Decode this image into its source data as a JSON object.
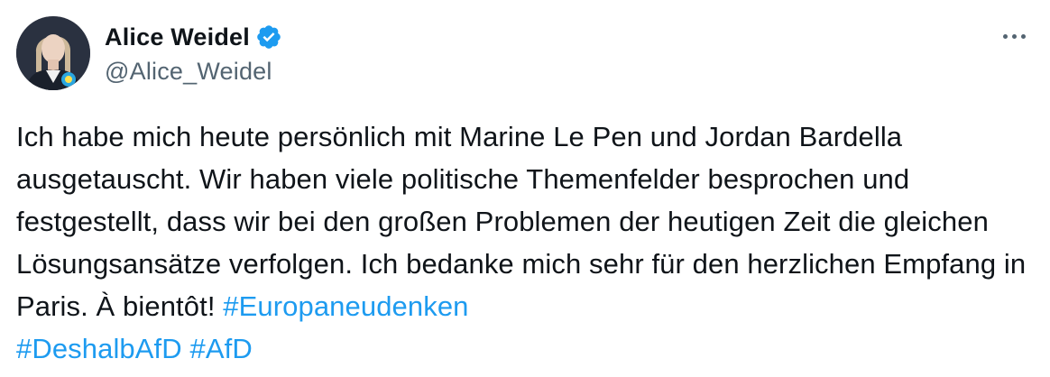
{
  "author": {
    "display_name": "Alice Weidel",
    "handle": "@Alice_Weidel",
    "verified": true,
    "verified_color": "#1d9bf0"
  },
  "menu": {
    "icon": "more-horizontal-icon"
  },
  "tweet": {
    "text": "Ich habe mich heute persönlich mit Marine Le Pen und Jordan Bardella ausgetauscht. Wir haben viele politische Themenfelder besprochen und festgestellt, dass wir bei den großen Problemen der heutigen Zeit die gleichen Lösungsansätze verfolgen. Ich bedanke mich sehr für den herzlichen Empfang in Paris. À bientôt!",
    "hashtags": [
      "#Europaneudenken",
      "#DeshalbAfD",
      "#AfD"
    ]
  },
  "colors": {
    "text": "#0f1419",
    "secondary": "#536471",
    "link": "#1d9bf0"
  }
}
